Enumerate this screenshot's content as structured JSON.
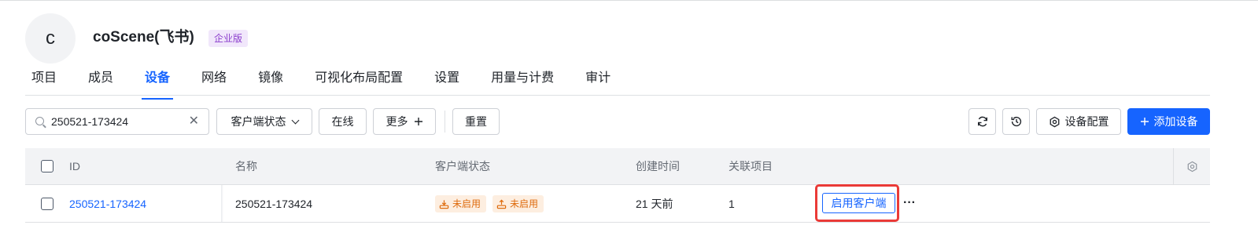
{
  "org": {
    "avatar_letter": "c",
    "name": "coScene(飞书)",
    "badge": "企业版"
  },
  "tabs": [
    {
      "label": "项目",
      "active": false
    },
    {
      "label": "成员",
      "active": false
    },
    {
      "label": "设备",
      "active": true
    },
    {
      "label": "网络",
      "active": false
    },
    {
      "label": "镜像",
      "active": false
    },
    {
      "label": "可视化布局配置",
      "active": false
    },
    {
      "label": "设置",
      "active": false
    },
    {
      "label": "用量与计费",
      "active": false
    },
    {
      "label": "审计",
      "active": false
    }
  ],
  "toolbar": {
    "search_value": "250521-173424",
    "clear_icon": "close-icon",
    "client_status_filter": "客户端状态",
    "online_filter": "在线",
    "more_filter": "更多",
    "reset": "重置",
    "device_config": "设备配置",
    "add_device": "添加设备"
  },
  "table": {
    "headers": {
      "id": "ID",
      "name": "名称",
      "client_status": "客户端状态",
      "created": "创建时间",
      "project": "关联项目"
    },
    "rows": [
      {
        "id": "250521-173424",
        "name": "250521-173424",
        "status_tags": [
          "未启用",
          "未启用"
        ],
        "created": "21 天前",
        "project": "1",
        "action": "启用客户端",
        "more": "···"
      }
    ]
  },
  "colors": {
    "accent": "#1664ff",
    "badge_bg": "#f1e7fb",
    "badge_text": "#8a3ccc",
    "warn_bg": "#fdeee0",
    "warn_text": "#de6b0d",
    "highlight": "#ea3a37"
  }
}
